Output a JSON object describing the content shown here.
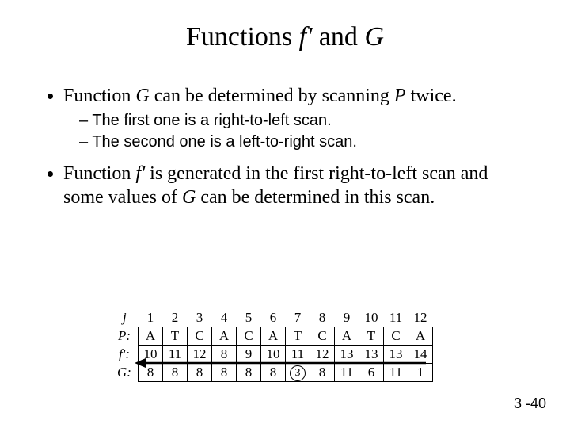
{
  "title": {
    "w1": "Functions ",
    "fi": "f'",
    "w2": " and ",
    "gi": "G"
  },
  "bullets": {
    "b1_pre": "Function ",
    "b1_G": "G",
    "b1_mid": " can be determined by scanning ",
    "b1_P": "P",
    "b1_post": " twice.",
    "b1_sub1": "The first one is a right-to-left scan.",
    "b1_sub2": "The second one is a left-to-right scan.",
    "b2_pre": "Function ",
    "b2_f": "f'",
    "b2_mid": " is generated in the first right-to-left scan and some values of ",
    "b2_G": "G",
    "b2_post": " can be determined in this scan."
  },
  "footer": "3 -40",
  "chart_data": {
    "type": "table",
    "row_labels": [
      "j",
      "P:",
      "f':",
      "G:"
    ],
    "j": [
      "1",
      "2",
      "3",
      "4",
      "5",
      "6",
      "7",
      "8",
      "9",
      "10",
      "11",
      "12"
    ],
    "P": [
      "A",
      "T",
      "C",
      "A",
      "C",
      "A",
      "T",
      "C",
      "A",
      "T",
      "C",
      "A"
    ],
    "fprime": [
      "10",
      "11",
      "12",
      "8",
      "9",
      "10",
      "11",
      "12",
      "13",
      "13",
      "13",
      "14"
    ],
    "G": [
      "8",
      "8",
      "8",
      "8",
      "8",
      "8",
      "3",
      "8",
      "11",
      "6",
      "11",
      "1"
    ],
    "circled_index": 6,
    "arrow": "right-to-left across f' row"
  }
}
